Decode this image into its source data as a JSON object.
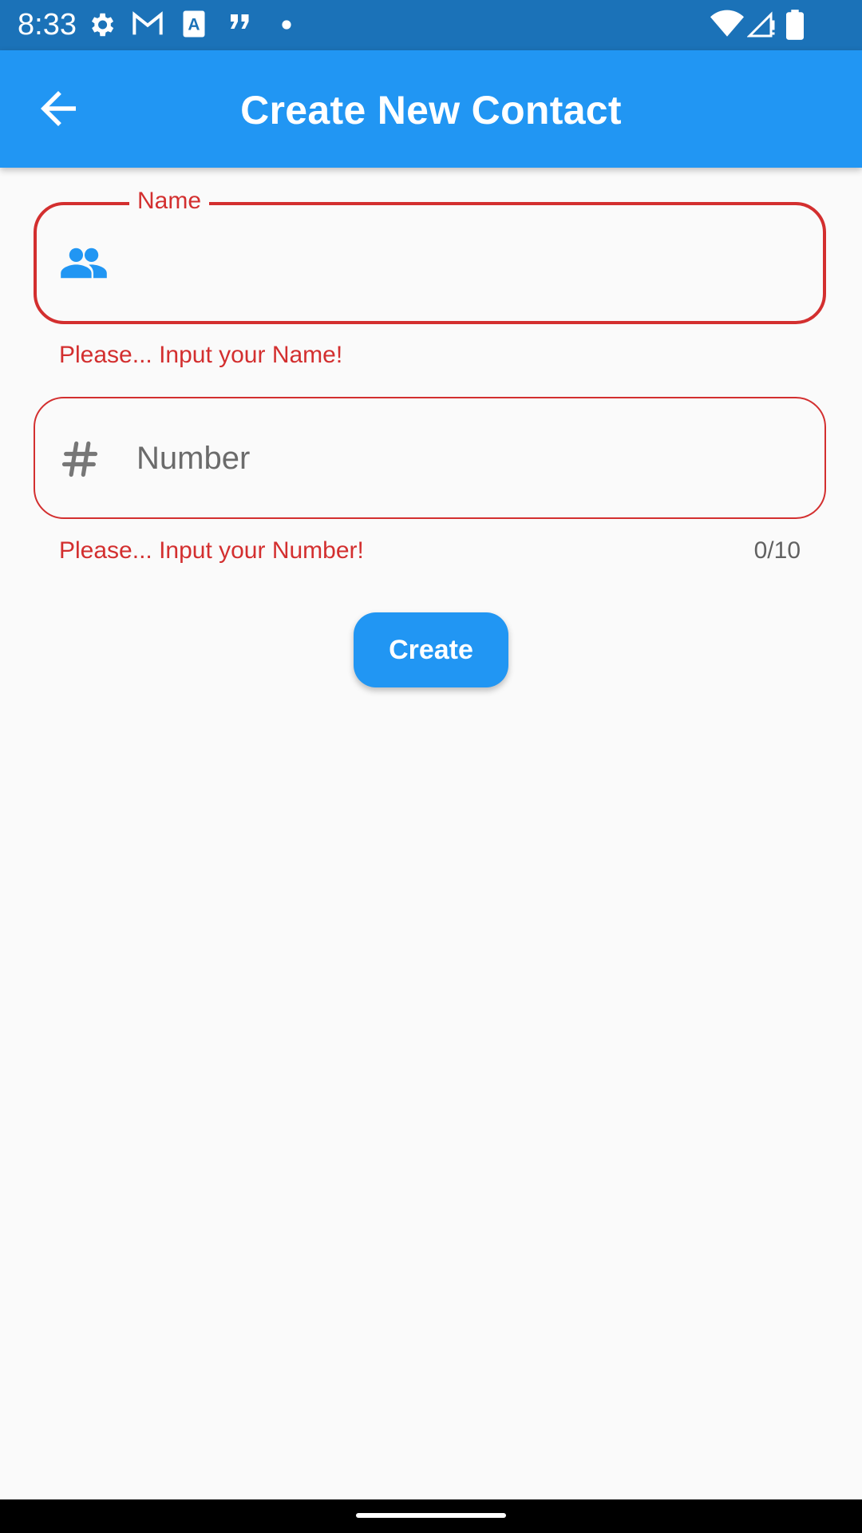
{
  "status_bar": {
    "time": "8:33",
    "icons": [
      "gear-icon",
      "gmail-icon",
      "a-font-icon",
      "quote-icon",
      "dot-icon",
      "wifi-icon",
      "signal-icon",
      "battery-icon"
    ]
  },
  "app_bar": {
    "title": "Create New Contact",
    "back_icon": "arrow-left-icon",
    "color": "#2196f3"
  },
  "form": {
    "name_field": {
      "label": "Name",
      "value": "",
      "icon": "people-icon",
      "error": "Please... Input your Name!"
    },
    "number_field": {
      "placeholder": "Number",
      "value": "",
      "icon": "hash-icon",
      "error": "Please... Input your Number!",
      "counter": "0/10"
    },
    "create_label": "Create",
    "error_color": "#d32f2f"
  }
}
